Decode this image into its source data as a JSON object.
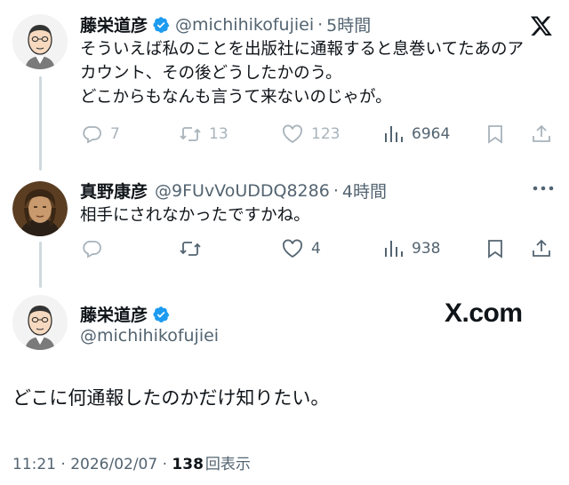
{
  "tweet1": {
    "display_name": "藤栄道彦",
    "handle": "@michihikofujiei",
    "separator": "·",
    "time": "5時間",
    "lines": [
      "そういえば私のことを出版社に通報すると息巻いてたあのア",
      "カウント、その後どうしたかのう。",
      "どこからもなんも言うて来ないのじゃが。"
    ],
    "replies": "7",
    "retweets": "13",
    "likes": "123",
    "views": "6964",
    "logo_icon": "x-logo-icon"
  },
  "tweet2": {
    "display_name": "真野康彦",
    "handle": "@9FUvVoUDDQ8286",
    "separator": "·",
    "time": "4時間",
    "text": "相手にされなかったですかね。",
    "likes": "4",
    "views": "938"
  },
  "quote": {
    "display_name": "藤栄道彦",
    "handle": "@michihikofujiei",
    "watermark": "X.com",
    "text": "どこに何通報したのかだけ知りたい。",
    "timestamp": "11:21 · 2026/02/07 · ",
    "view_count": "138",
    "view_label": "回表示"
  },
  "colors": {
    "verified": "#1d9bf0",
    "muted": "#536471",
    "thread_line": "#cfd9de"
  }
}
